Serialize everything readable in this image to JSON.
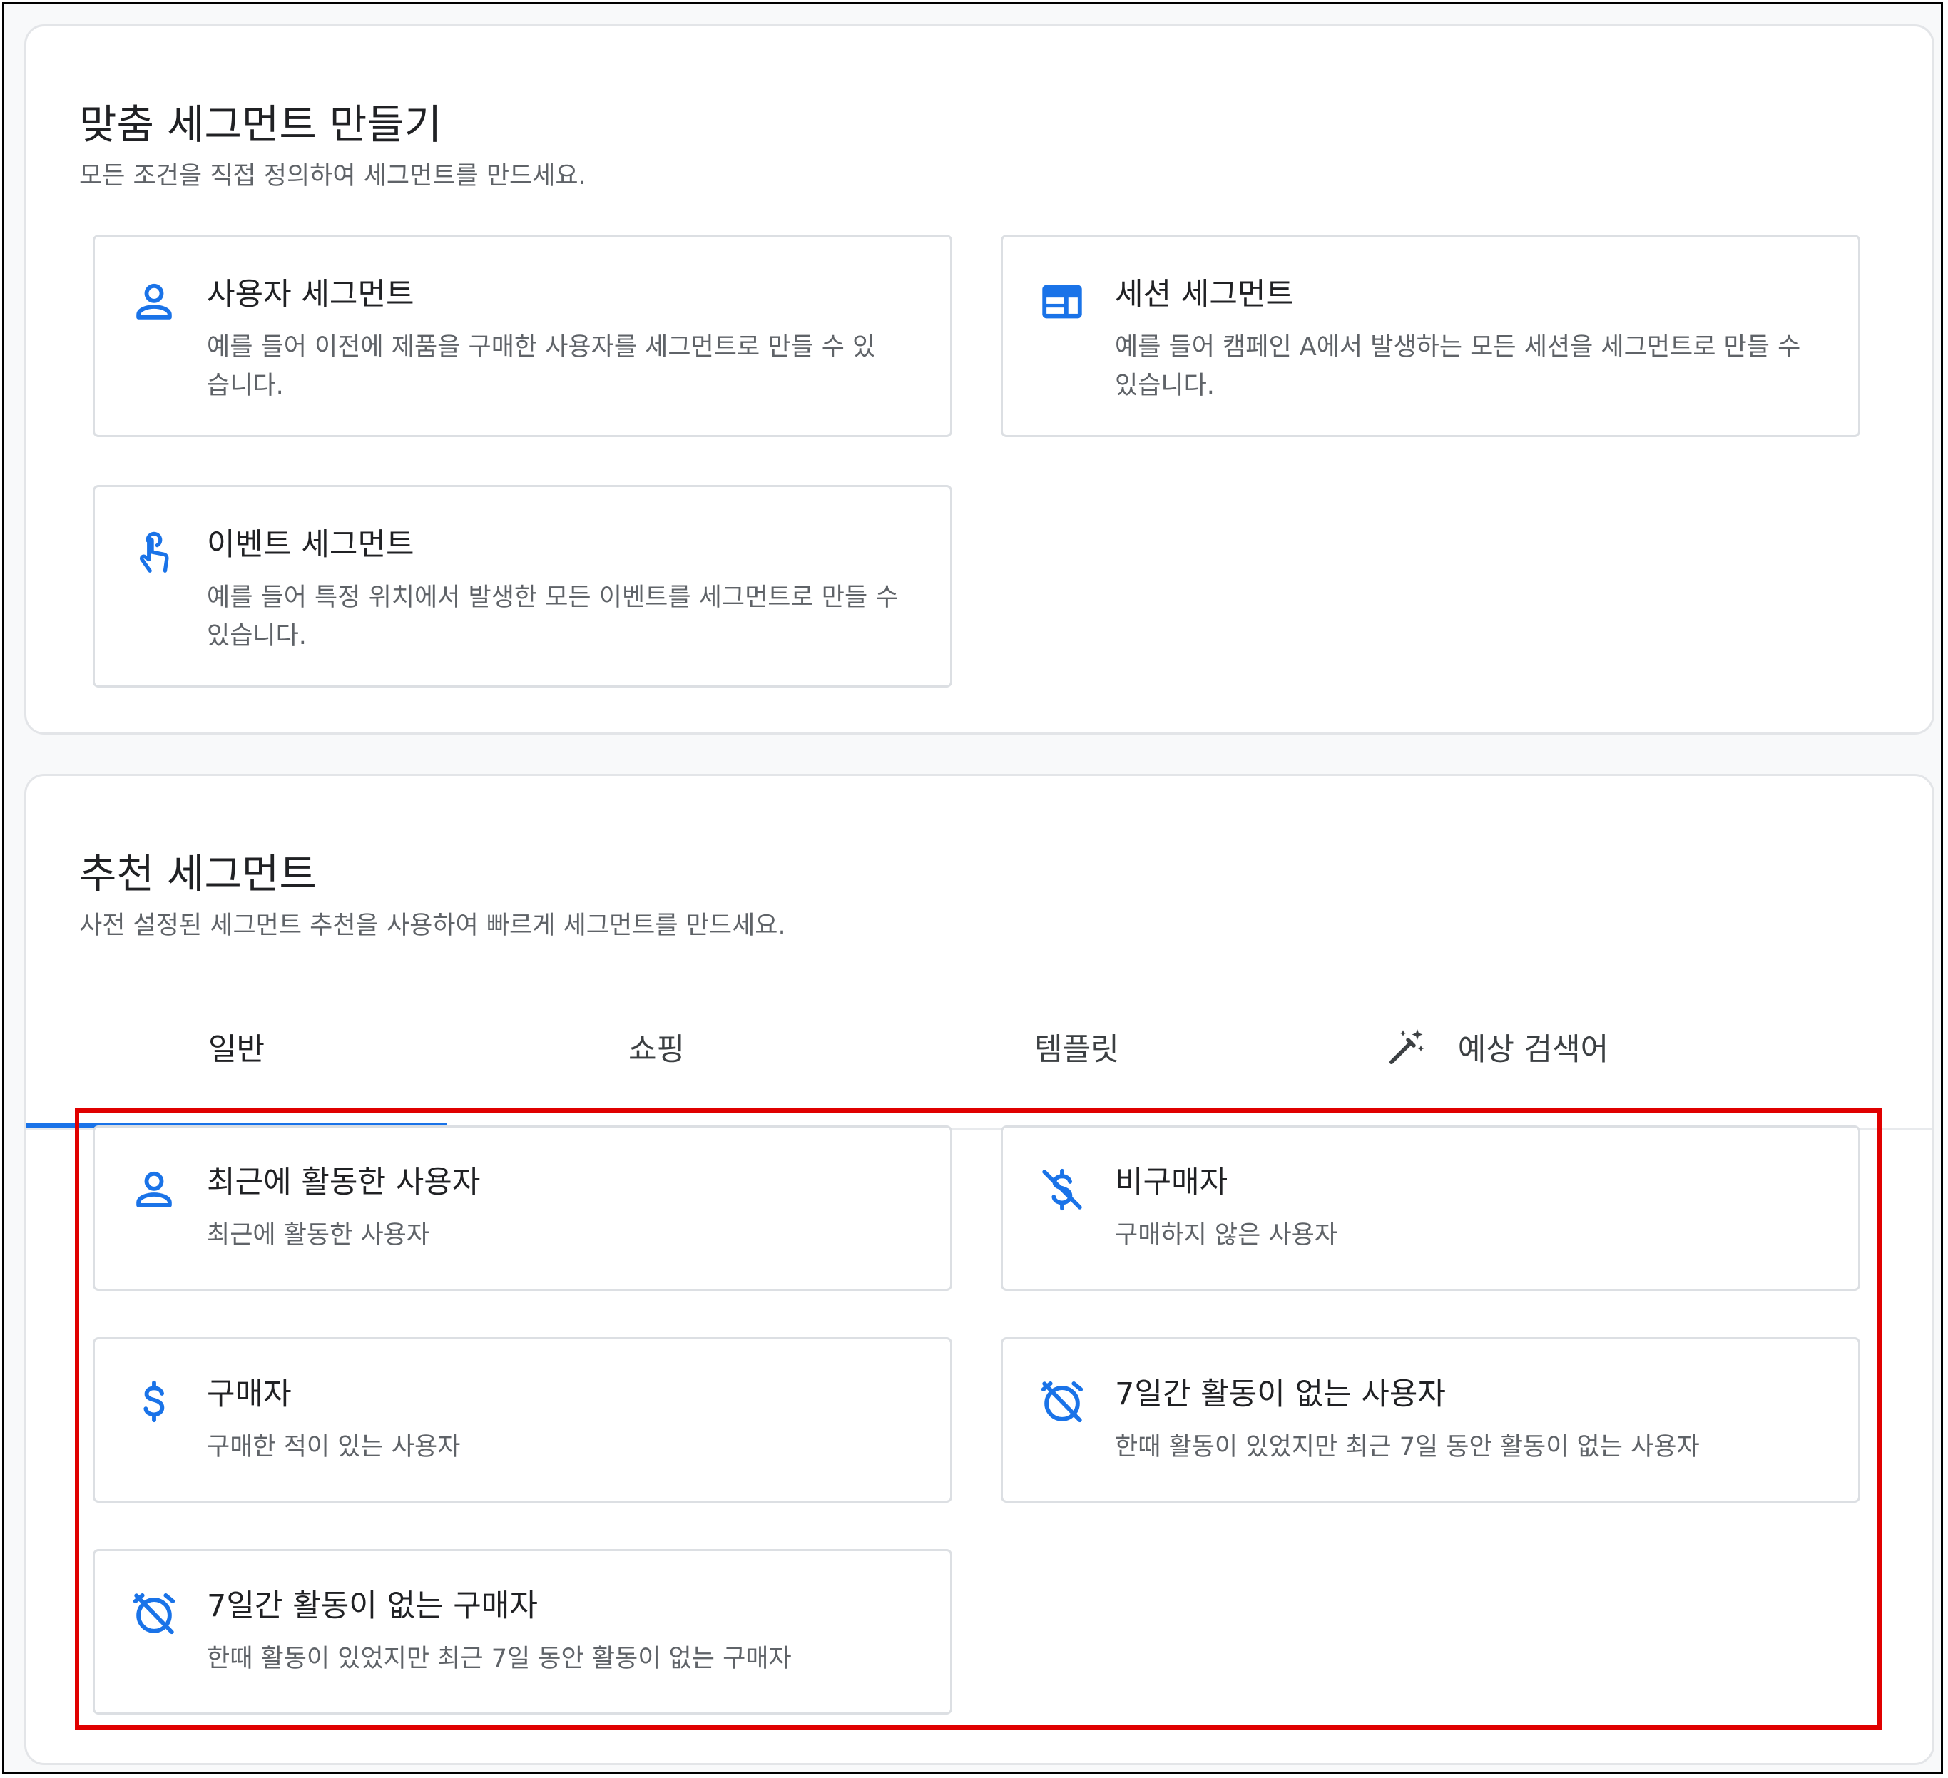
{
  "custom": {
    "title": "맞춤 세그먼트 만들기",
    "subtitle": "모든 조건을 직접 정의하여 세그먼트를 만드세요.",
    "cards": [
      {
        "icon": "person-icon",
        "title": "사용자 세그먼트",
        "desc": "예를 들어 이전에 제품을 구매한 사용자를 세그먼트로 만들 수 있습니다."
      },
      {
        "icon": "session-icon",
        "title": "세션 세그먼트",
        "desc": "예를 들어 캠페인 A에서 발생하는 모든 세션을 세그먼트로 만들 수 있습니다."
      },
      {
        "icon": "touch-icon",
        "title": "이벤트 세그먼트",
        "desc": "예를 들어 특정 위치에서 발생한 모든 이벤트를 세그먼트로 만들 수 있습니다."
      }
    ]
  },
  "suggested": {
    "title": "추천 세그먼트",
    "subtitle": "사전 설정된 세그먼트 추천을 사용하여 빠르게 세그먼트를 만드세요.",
    "tabs": [
      {
        "label": "일반",
        "selected": true
      },
      {
        "label": "쇼핑",
        "selected": false
      },
      {
        "label": "템플릿",
        "selected": false
      },
      {
        "label": "예상 검색어",
        "selected": false,
        "icon": "magic-wand-icon"
      }
    ],
    "cards": [
      {
        "icon": "person-icon",
        "title": "최근에 활동한 사용자",
        "desc": "최근에 활동한 사용자"
      },
      {
        "icon": "money-off-icon",
        "title": "비구매자",
        "desc": "구매하지 않은 사용자"
      },
      {
        "icon": "dollar-icon",
        "title": "구매자",
        "desc": "구매한 적이 있는 사용자"
      },
      {
        "icon": "alarm-off-icon",
        "title": "7일간 활동이 없는 사용자",
        "desc": "한때 활동이 있었지만 최근 7일 동안 활동이 없는 사용자"
      },
      {
        "icon": "alarm-off-icon",
        "title": "7일간 활동이 없는 구매자",
        "desc": "한때 활동이 있었지만 최근 7일 동안 활동이 없는 구매자"
      }
    ]
  },
  "colors": {
    "accent": "#1a73e8",
    "highlight": "#e00000",
    "card_border": "#dcdfe3",
    "panel_background": "#f8f9fa"
  }
}
